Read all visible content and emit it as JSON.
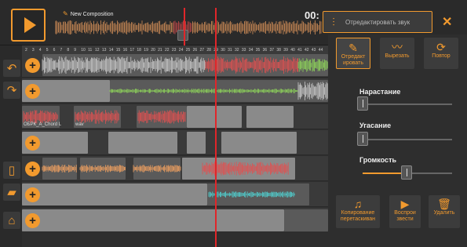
{
  "header": {
    "composition_title": "New Composition",
    "timecode": "00:",
    "edit_panel_label": "Отредактировать звук"
  },
  "left_toolbar": {
    "icons": [
      "undo-icon",
      "redo-icon",
      "file-icon",
      "folder-icon",
      "home-icon"
    ]
  },
  "ruler": {
    "ticks": [
      "2",
      "3",
      "4",
      "5",
      "6",
      "7",
      "8",
      "9",
      "10",
      "11",
      "12",
      "13",
      "14",
      "15",
      "16",
      "17",
      "18",
      "19",
      "20",
      "21",
      "22",
      "23",
      "24",
      "25",
      "26",
      "27",
      "28",
      "29",
      "30",
      "31",
      "32",
      "33",
      "34",
      "35",
      "36",
      "37",
      "38",
      "39",
      "40",
      "41",
      "42",
      "43",
      "44"
    ]
  },
  "tracks": {
    "add_label": "+",
    "clip_labels": [
      "ОБРК_А_Chord L",
      "wav"
    ]
  },
  "tools": {
    "edit": "Отредакт ировать",
    "cut": "Вырезать",
    "repeat": "Повтор"
  },
  "sliders": {
    "fade_in": {
      "label": "Нарастание",
      "value": 0.0
    },
    "fade_out": {
      "label": "Угасание",
      "value": 0.0
    },
    "volume": {
      "label": "Громкость",
      "value": 0.5
    }
  },
  "actions": {
    "copy_drag": "Копирование перетаскиван",
    "play": "Воспрои звести",
    "delete": "Удалить"
  },
  "colors": {
    "accent": "#f29a2e",
    "playhead": "#e0262a",
    "wave_orange": "#f0a060",
    "wave_red": "#e05050",
    "wave_green": "#8fd65a",
    "wave_cyan": "#4fd0d0",
    "wave_grey": "#c8c8c8"
  }
}
